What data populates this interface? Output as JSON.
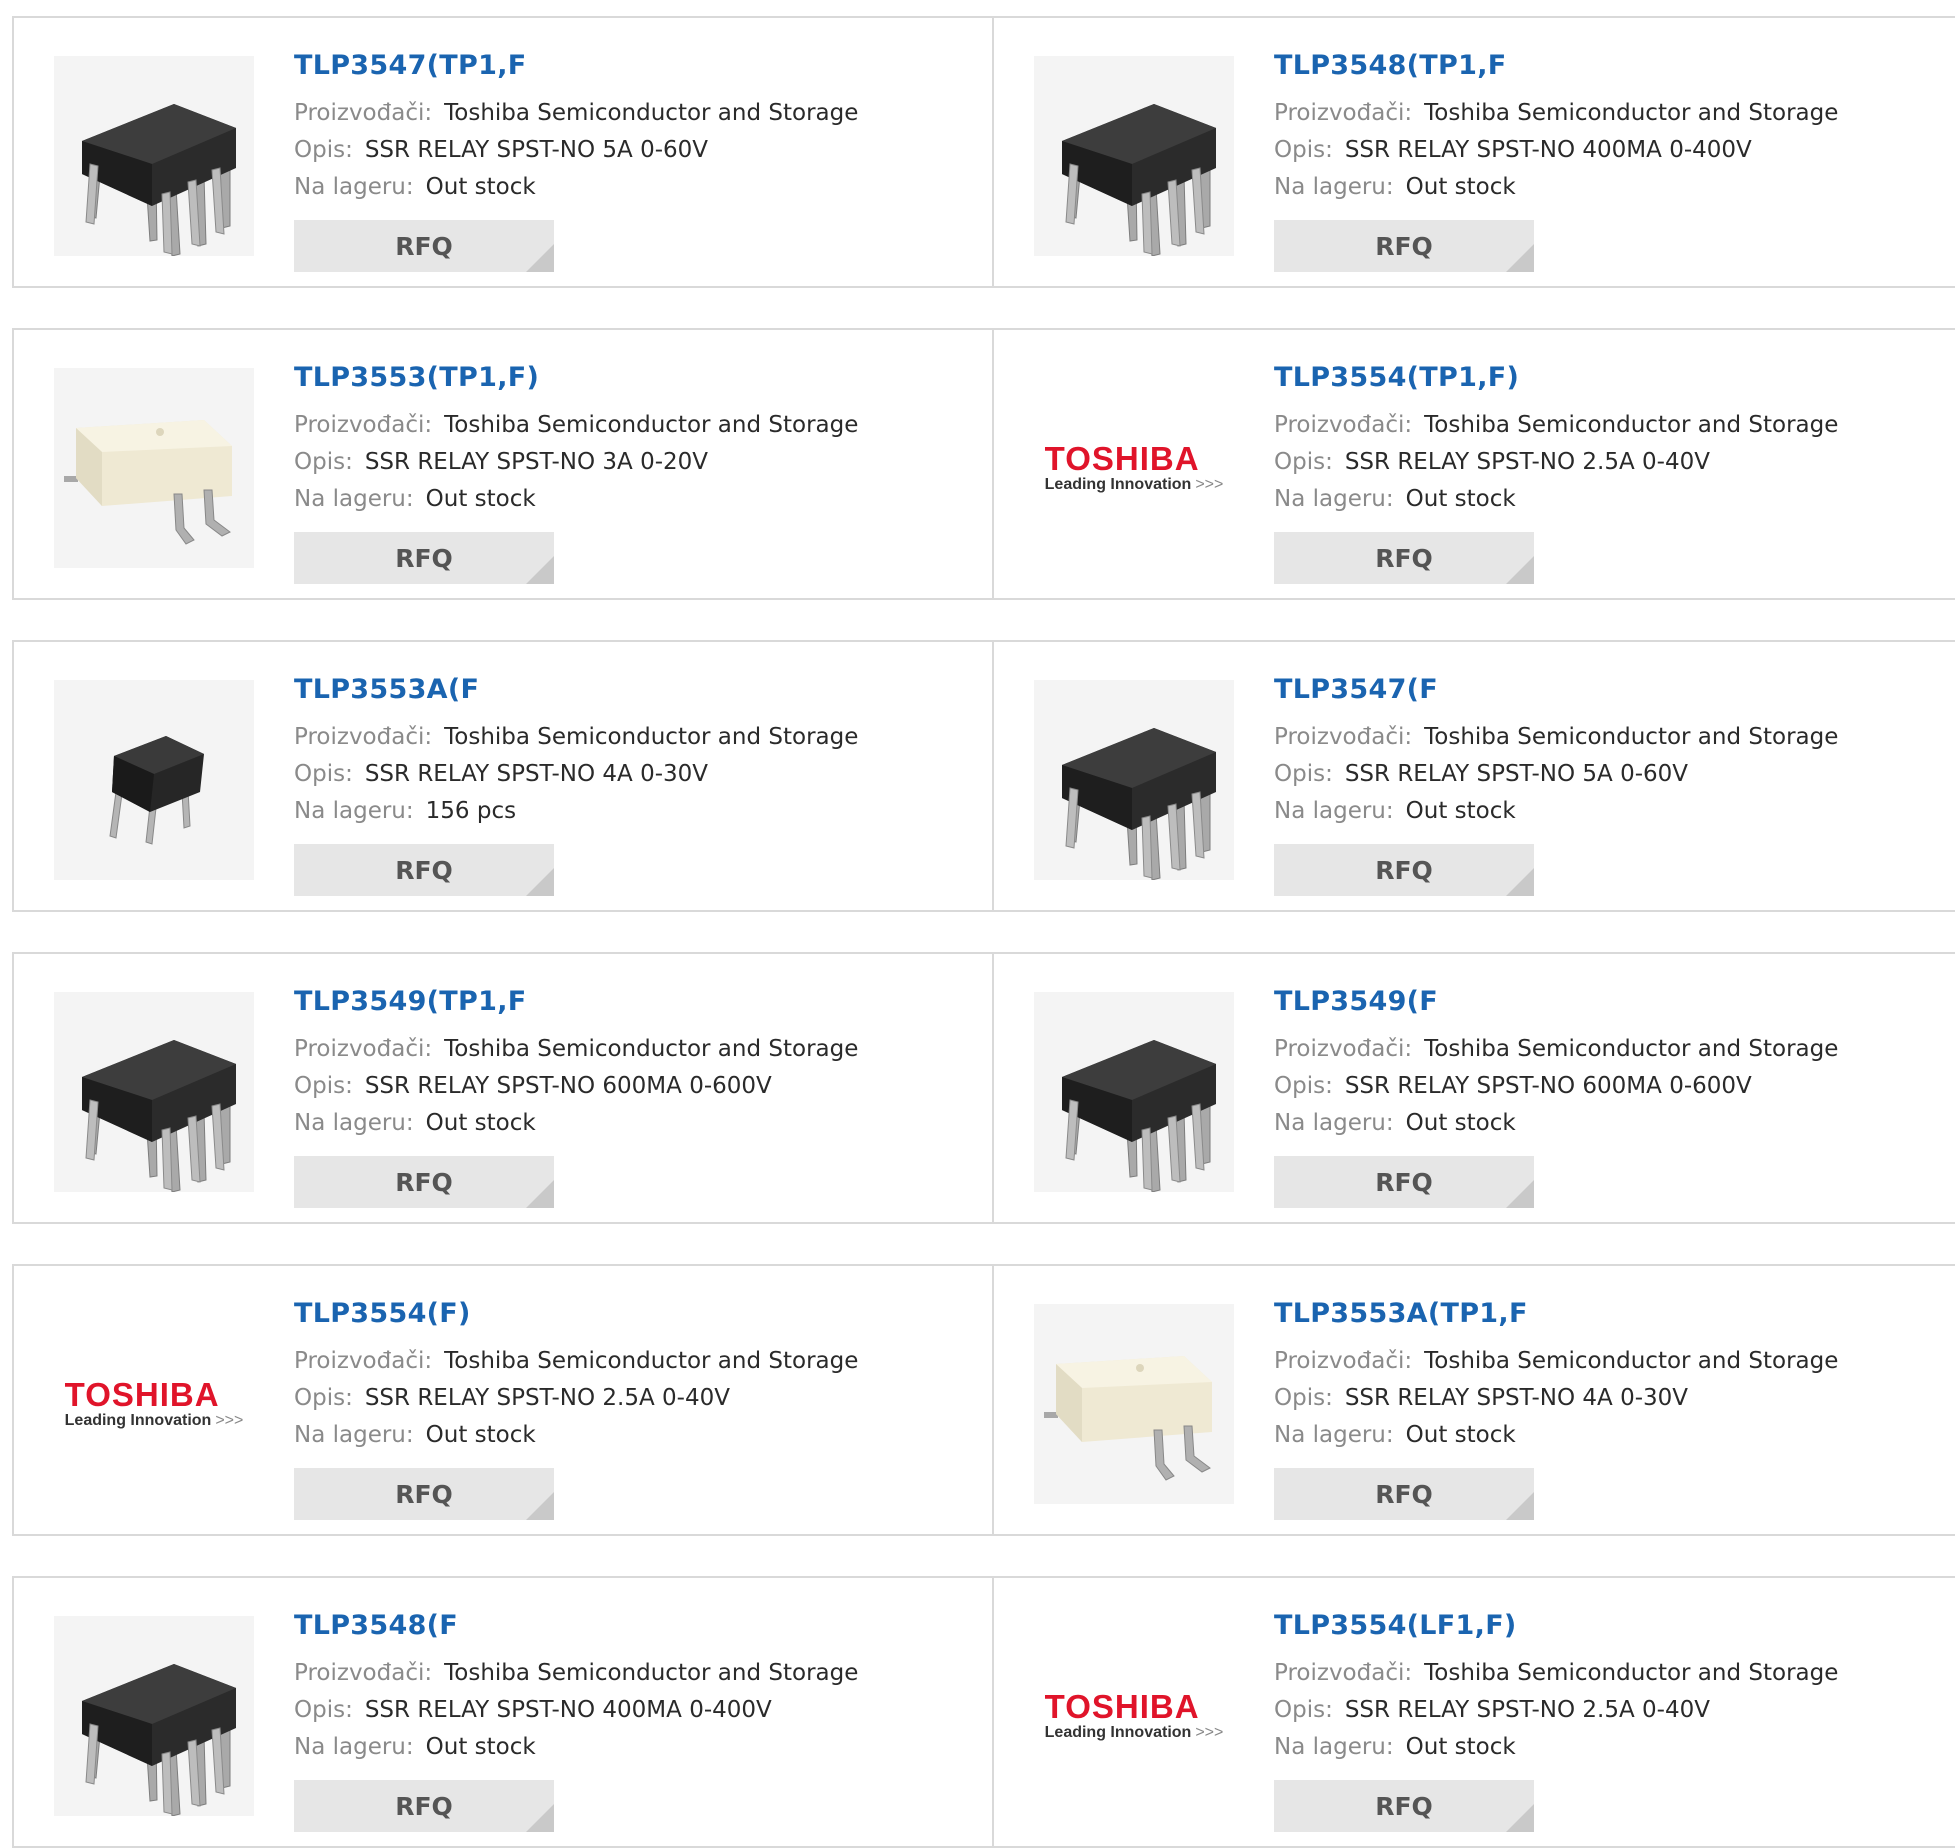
{
  "labels": {
    "manufacturer": "Proizvođači:",
    "description": "Opis:",
    "stock": "Na lageru:",
    "rfq": "RFQ"
  },
  "logo": {
    "brand": "TOSHIBA",
    "tagline": "Leading Innovation",
    "arrows": ">>>"
  },
  "products": [
    {
      "part": "TLP3547(TP1,F",
      "manufacturer": "Toshiba Semiconductor and Storage",
      "description": "SSR RELAY SPST-NO 5A 0-60V",
      "stock": "Out stock",
      "image": "dip6-chip-icon"
    },
    {
      "part": "TLP3548(TP1,F",
      "manufacturer": "Toshiba Semiconductor and Storage",
      "description": "SSR RELAY SPST-NO 400MA 0-400V",
      "stock": "Out stock",
      "image": "dip6-chip-icon"
    },
    {
      "part": "TLP3553(TP1,F)",
      "manufacturer": "Toshiba Semiconductor and Storage",
      "description": "SSR RELAY SPST-NO 3A 0-20V",
      "stock": "Out stock",
      "image": "smd-white-chip-icon"
    },
    {
      "part": "TLP3554(TP1,F)",
      "manufacturer": "Toshiba Semiconductor and Storage",
      "description": "SSR RELAY SPST-NO 2.5A 0-40V",
      "stock": "Out stock",
      "image": "toshiba-logo"
    },
    {
      "part": "TLP3553A(F",
      "manufacturer": "Toshiba Semiconductor and Storage",
      "description": "SSR RELAY SPST-NO 4A 0-30V",
      "stock": "156 pcs",
      "image": "dip4-small-chip-icon"
    },
    {
      "part": "TLP3547(F",
      "manufacturer": "Toshiba Semiconductor and Storage",
      "description": "SSR RELAY SPST-NO 5A 0-60V",
      "stock": "Out stock",
      "image": "dip6-chip-icon"
    },
    {
      "part": "TLP3549(TP1,F",
      "manufacturer": "Toshiba Semiconductor and Storage",
      "description": "SSR RELAY SPST-NO 600MA 0-600V",
      "stock": "Out stock",
      "image": "dip6-chip-icon"
    },
    {
      "part": "TLP3549(F",
      "manufacturer": "Toshiba Semiconductor and Storage",
      "description": "SSR RELAY SPST-NO 600MA 0-600V",
      "stock": "Out stock",
      "image": "dip6-chip-icon"
    },
    {
      "part": "TLP3554(F)",
      "manufacturer": "Toshiba Semiconductor and Storage",
      "description": "SSR RELAY SPST-NO 2.5A 0-40V",
      "stock": "Out stock",
      "image": "toshiba-logo"
    },
    {
      "part": "TLP3553A(TP1,F",
      "manufacturer": "Toshiba Semiconductor and Storage",
      "description": "SSR RELAY SPST-NO 4A 0-30V",
      "stock": "Out stock",
      "image": "smd-white-chip-icon"
    },
    {
      "part": "TLP3548(F",
      "manufacturer": "Toshiba Semiconductor and Storage",
      "description": "SSR RELAY SPST-NO 400MA 0-400V",
      "stock": "Out stock",
      "image": "dip6-chip-icon"
    },
    {
      "part": "TLP3554(LF1,F)",
      "manufacturer": "Toshiba Semiconductor and Storage",
      "description": "SSR RELAY SPST-NO 2.5A 0-40V",
      "stock": "Out stock",
      "image": "toshiba-logo"
    }
  ]
}
